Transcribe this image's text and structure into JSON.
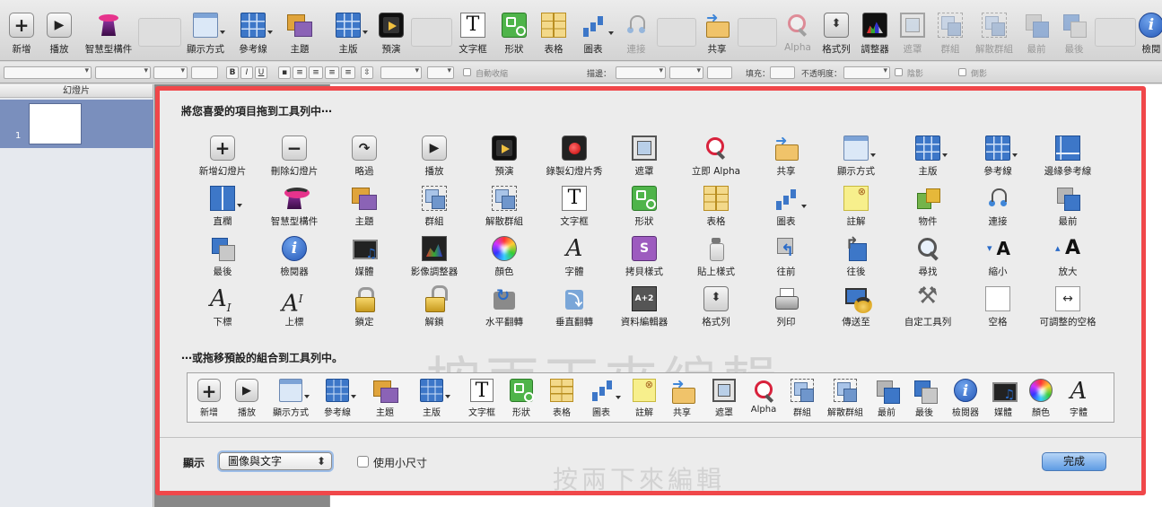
{
  "toolbar": {
    "items": [
      {
        "label": "新增",
        "icon": "plus-icon"
      },
      {
        "label": "播放",
        "icon": "play-icon"
      },
      {
        "label": "智慧型構件",
        "icon": "magic-hat-icon"
      },
      {
        "label": "顯示方式",
        "icon": "view-icon"
      },
      {
        "label": "參考線",
        "icon": "guides-icon"
      },
      {
        "label": "主題",
        "icon": "themes-icon"
      },
      {
        "label": "主版",
        "icon": "masters-icon"
      },
      {
        "label": "預演",
        "icon": "rehearse-icon"
      },
      {
        "label": "文字框",
        "icon": "text-box-icon"
      },
      {
        "label": "形狀",
        "icon": "shapes-icon"
      },
      {
        "label": "表格",
        "icon": "table-icon"
      },
      {
        "label": "圖表",
        "icon": "chart-icon"
      },
      {
        "label": "連接",
        "icon": "connection-icon"
      },
      {
        "label": "共享",
        "icon": "share-icon"
      },
      {
        "label": "Alpha",
        "icon": "alpha-icon"
      },
      {
        "label": "格式列",
        "icon": "format-bar-icon"
      },
      {
        "label": "調整器",
        "icon": "adjust-icon"
      },
      {
        "label": "遮罩",
        "icon": "mask-icon"
      },
      {
        "label": "群組",
        "icon": "group-icon"
      },
      {
        "label": "解散群組",
        "icon": "ungroup-icon"
      },
      {
        "label": "最前",
        "icon": "front-icon"
      },
      {
        "label": "最後",
        "icon": "back-icon"
      },
      {
        "label": "檢閱",
        "icon": "inspector-icon"
      }
    ]
  },
  "formatbar": {
    "autofit_label": "自動收縮",
    "stroke_label": "描邊：",
    "fill_label": "填充：",
    "opacity_label": "不透明度：",
    "shadow_label": "陰影",
    "reflection_label": "倒影",
    "bold": "B",
    "italic": "I",
    "underline": "U"
  },
  "slides": {
    "header": "幻燈片",
    "slide_number": "1"
  },
  "sheet": {
    "title": "將您喜愛的項目拖到工具列中⋯",
    "items": [
      {
        "label": "新增幻燈片",
        "icon": "new-slide-icon"
      },
      {
        "label": "刪除幻燈片",
        "icon": "delete-slide-icon"
      },
      {
        "label": "略過",
        "icon": "skip-icon"
      },
      {
        "label": "播放",
        "icon": "play-icon"
      },
      {
        "label": "預演",
        "icon": "rehearse-icon"
      },
      {
        "label": "錄製幻燈片秀",
        "icon": "record-icon"
      },
      {
        "label": "遮罩",
        "icon": "mask-icon"
      },
      {
        "label": "立即 Alpha",
        "icon": "alpha-icon"
      },
      {
        "label": "共享",
        "icon": "share-icon"
      },
      {
        "label": "顯示方式",
        "icon": "view-icon"
      },
      {
        "label": "主版",
        "icon": "masters-icon"
      },
      {
        "label": "參考線",
        "icon": "guides-icon"
      },
      {
        "label": "邊緣參考線",
        "icon": "edge-guides-icon"
      },
      {
        "label": "直欄",
        "icon": "columns-icon"
      },
      {
        "label": "智慧型構件",
        "icon": "magic-hat-icon"
      },
      {
        "label": "主題",
        "icon": "themes-icon"
      },
      {
        "label": "群組",
        "icon": "group-icon"
      },
      {
        "label": "解散群組",
        "icon": "ungroup-icon"
      },
      {
        "label": "文字框",
        "icon": "text-box-icon"
      },
      {
        "label": "形狀",
        "icon": "shapes-icon"
      },
      {
        "label": "表格",
        "icon": "table-icon"
      },
      {
        "label": "圖表",
        "icon": "chart-icon"
      },
      {
        "label": "註解",
        "icon": "comment-icon"
      },
      {
        "label": "物件",
        "icon": "objects-icon"
      },
      {
        "label": "連接",
        "icon": "connection-icon"
      },
      {
        "label": "最前",
        "icon": "front-icon"
      },
      {
        "label": "最後",
        "icon": "back-icon"
      },
      {
        "label": "檢閱器",
        "icon": "inspector-icon"
      },
      {
        "label": "媒體",
        "icon": "media-icon"
      },
      {
        "label": "影像調整器",
        "icon": "image-adjust-icon"
      },
      {
        "label": "顏色",
        "icon": "color-wheel-icon"
      },
      {
        "label": "字體",
        "icon": "font-icon"
      },
      {
        "label": "拷貝樣式",
        "icon": "copy-style-icon"
      },
      {
        "label": "貼上樣式",
        "icon": "paste-style-icon"
      },
      {
        "label": "往前",
        "icon": "forward-icon"
      },
      {
        "label": "往後",
        "icon": "backward-icon"
      },
      {
        "label": "尋找",
        "icon": "find-icon"
      },
      {
        "label": "縮小",
        "icon": "smaller-icon"
      },
      {
        "label": "放大",
        "icon": "bigger-icon"
      },
      {
        "label": "下標",
        "icon": "subscript-icon"
      },
      {
        "label": "上標",
        "icon": "superscript-icon"
      },
      {
        "label": "鎖定",
        "icon": "lock-icon"
      },
      {
        "label": "解鎖",
        "icon": "unlock-icon"
      },
      {
        "label": "水平翻轉",
        "icon": "flip-horizontal-icon"
      },
      {
        "label": "垂直翻轉",
        "icon": "flip-vertical-icon"
      },
      {
        "label": "資料編輯器",
        "icon": "data-editor-icon"
      },
      {
        "label": "格式列",
        "icon": "format-bar-icon"
      },
      {
        "label": "列印",
        "icon": "print-icon"
      },
      {
        "label": "傳送至",
        "icon": "send-to-icon"
      },
      {
        "label": "自定工具列",
        "icon": "customize-toolbar-icon"
      },
      {
        "label": "空格",
        "icon": "space-icon"
      },
      {
        "label": "可調整的空格",
        "icon": "flexible-space-icon"
      }
    ],
    "default_title": "⋯或拖移預設的組合到工具列中。",
    "default_items": [
      {
        "label": "新增",
        "icon": "plus-icon"
      },
      {
        "label": "播放",
        "icon": "play-icon"
      },
      {
        "label": "顯示方式",
        "icon": "view-icon"
      },
      {
        "label": "參考線",
        "icon": "guides-icon"
      },
      {
        "label": "主題",
        "icon": "themes-icon"
      },
      {
        "label": "主版",
        "icon": "masters-icon"
      },
      {
        "label": "文字框",
        "icon": "text-box-icon"
      },
      {
        "label": "形狀",
        "icon": "shapes-icon"
      },
      {
        "label": "表格",
        "icon": "table-icon"
      },
      {
        "label": "圖表",
        "icon": "chart-icon"
      },
      {
        "label": "註解",
        "icon": "comment-icon"
      },
      {
        "label": "共享",
        "icon": "share-icon"
      },
      {
        "label": "遮罩",
        "icon": "mask-icon"
      },
      {
        "label": "Alpha",
        "icon": "alpha-icon"
      },
      {
        "label": "群組",
        "icon": "group-icon"
      },
      {
        "label": "解散群組",
        "icon": "ungroup-icon"
      },
      {
        "label": "最前",
        "icon": "front-icon"
      },
      {
        "label": "最後",
        "icon": "back-icon"
      },
      {
        "label": "檢閱器",
        "icon": "inspector-icon"
      },
      {
        "label": "媒體",
        "icon": "media-icon"
      },
      {
        "label": "顏色",
        "icon": "color-wheel-icon"
      },
      {
        "label": "字體",
        "icon": "font-icon"
      }
    ],
    "show_label": "顯示",
    "show_value": "圖像與文字",
    "small_size_label": "使用小尺寸",
    "small_size_checked": false,
    "done_label": "完成"
  },
  "watermark": {
    "large": "按兩下來編輯",
    "small": "按兩下來編輯"
  },
  "colors": {
    "highlight_border": "#f0474a",
    "done_button": "#5e9be3",
    "slide_selection": "#7a8fbd"
  }
}
